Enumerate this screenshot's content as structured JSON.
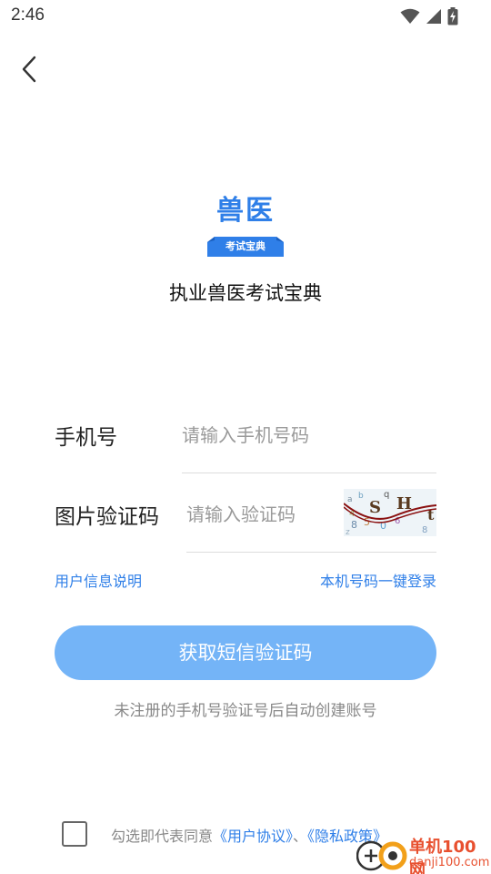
{
  "status_bar": {
    "time": "2:46",
    "icons": [
      "wifi-icon",
      "cellular-signal-icon",
      "battery-charging-icon"
    ]
  },
  "header": {
    "back_icon": "chevron-left-icon"
  },
  "logo": {
    "title": "兽医",
    "subtitle": "考试宝典",
    "color": "#2f7fe8"
  },
  "app_name": "执业兽医考试宝典",
  "form": {
    "phone": {
      "label": "手机号",
      "placeholder": "请输入手机号码",
      "value": ""
    },
    "captcha": {
      "label": "图片验证码",
      "placeholder": "请输入验证码",
      "value": ""
    }
  },
  "links": {
    "user_info": "用户信息说明",
    "one_click_login": "本机号码一键登录"
  },
  "primary_button": {
    "label": "获取短信验证码",
    "color": "#74b4f7"
  },
  "hint": "未注册的手机号验证号后自动创建账号",
  "agreement": {
    "checked": false,
    "prefix": "勾选即代表同意",
    "user_agreement": "《用户协议》",
    "separator": "、",
    "privacy_policy": "《隐私政策》"
  },
  "watermark": {
    "line1": "单机100网",
    "line2": "danji100.com"
  }
}
